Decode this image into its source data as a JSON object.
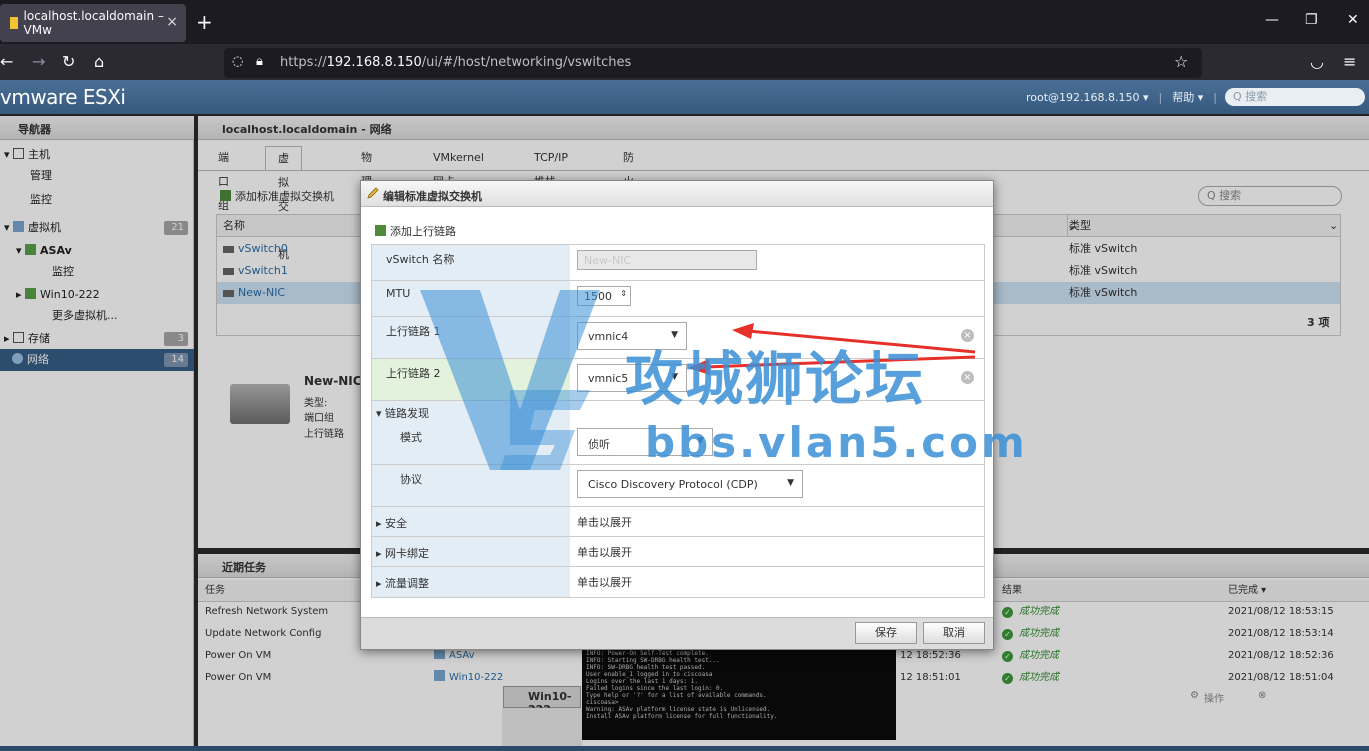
{
  "browser": {
    "tab_title": "localhost.localdomain – VMw",
    "tab_close": "×",
    "new_tab": "+",
    "url_prefix": "https://",
    "url_host": "192.168.8.150",
    "url_path": "/ui/#/host/networking/vswitches"
  },
  "esxi": {
    "logo": "vmware ESXi",
    "user": "root@192.168.8.150 ▾",
    "help": "帮助 ▾",
    "search_placeholder": "Q 搜索"
  },
  "navigator": {
    "title": "导航器",
    "items": [
      {
        "label": "主机"
      },
      {
        "label": "管理"
      },
      {
        "label": "监控"
      },
      {
        "label": "虚拟机",
        "badge": "21"
      },
      {
        "label": "ASAv"
      },
      {
        "label": "监控"
      },
      {
        "label": "Win10-222"
      },
      {
        "label": "更多虚拟机..."
      },
      {
        "label": "存储",
        "badge": "3"
      },
      {
        "label": "网络",
        "badge": "14"
      }
    ]
  },
  "main": {
    "title": "localhost.localdomain - 网络",
    "tabs": [
      "端口组",
      "虚拟交换机",
      "物理网卡",
      "VMkernel 网卡",
      "TCP/IP 堆栈",
      "防火墙规则"
    ],
    "toolbar_add": "添加标准虚拟交换机",
    "search_placeholder": "Q 搜索",
    "col_name": "名称",
    "col_type": "类型",
    "rows": [
      {
        "name": "vSwitch0",
        "type": "标准 vSwitch"
      },
      {
        "name": "vSwitch1",
        "type": "标准 vSwitch"
      },
      {
        "name": "New-NIC",
        "type": "标准 vSwitch"
      }
    ],
    "count": "3 项",
    "detail_name": "New-NIC",
    "detail_type": "类型:",
    "detail_portgroup": "端口组",
    "detail_uplink": "上行链路"
  },
  "tasks": {
    "title": "近期任务",
    "col_task": "任务",
    "col_result": "结果",
    "col_done": "已完成 ▾",
    "rows": [
      {
        "task": "Refresh Network System",
        "target": "",
        "queued": "",
        "result": "成功完成",
        "done": "2021/08/12 18:53:15"
      },
      {
        "task": "Update Network Config",
        "target": "",
        "queued": "",
        "result": "成功完成",
        "done": "2021/08/12 18:53:14"
      },
      {
        "task": "Power On VM",
        "target": "ASAv",
        "queued": "12 18:52:36",
        "result": "成功完成",
        "done": "2021/08/12 18:52:36"
      },
      {
        "task": "Power On VM",
        "target": "Win10-222",
        "queued": "12 18:51:01",
        "result": "成功完成",
        "done": "2021/08/12 18:51:04"
      }
    ]
  },
  "console": {
    "lines": [
      "INFO: Power-On Self-Test complete.",
      "",
      "INFO: Starting SW-DRBG health test...",
      "INFO: SW-DRBG health test passed.",
      "User enable_1 logged in to ciscoasa",
      "Logins over the last 1 days: 1.",
      "Failed logins since the last login: 0.",
      "Type help or '?' for a list of available commands.",
      "ciscoasa>",
      "Warning: ASAv platform license state is Unlicensed.",
      "Install ASAv platform license for full functionality."
    ]
  },
  "minimized": {
    "title": "Win10-222",
    "actions": "操作"
  },
  "dialog": {
    "title": "编辑标准虚拟交换机",
    "add_uplink": "添加上行链路",
    "vswitch_name_label": "vSwitch 名称",
    "vswitch_name_value": "New-NIC",
    "mtu_label": "MTU",
    "mtu_value": "1500",
    "uplink1_label": "上行链路 1",
    "uplink1_value": "vmnic4",
    "uplink2_label": "上行链路 2",
    "uplink2_value": "vmnic5",
    "link_discovery_label": "链路发现",
    "mode_label": "模式",
    "mode_value": "侦听",
    "protocol_label": "协议",
    "protocol_value": "Cisco Discovery Protocol (CDP)",
    "security_label": "安全",
    "teaming_label": "网卡绑定",
    "shaping_label": "流量调整",
    "expand_hint": "单击以展开",
    "save": "保存",
    "cancel": "取消"
  },
  "watermark": {
    "brand": "攻城狮论坛",
    "site": "bbs.vlan5.com"
  },
  "colors": {
    "header": "#36597e",
    "selected": "#385f87",
    "arrow": "#e8302a",
    "watermark": "#3a8fd6"
  }
}
